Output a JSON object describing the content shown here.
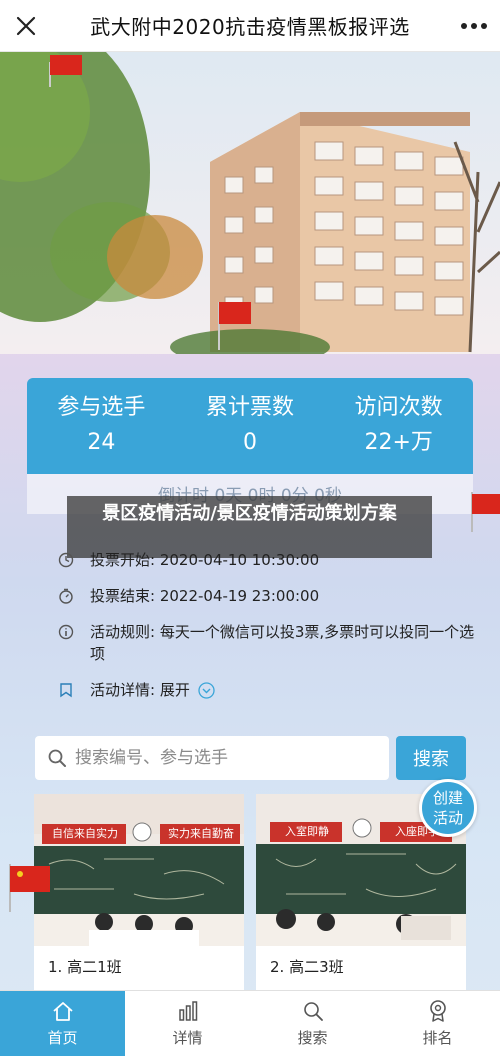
{
  "header": {
    "title": "武大附中2020抗击疫情黑板报评选",
    "close_icon": "close-icon",
    "more_icon": "more-dots-icon"
  },
  "stats": {
    "items": [
      {
        "label": "参与选手",
        "value": "24"
      },
      {
        "label": "累计票数",
        "value": "0"
      },
      {
        "label": "访问次数",
        "value": "22+万"
      }
    ],
    "countdown": "倒计时 0天 0时 0分 0秒"
  },
  "overlay_caption": "景区疫情活动/景区疫情活动策划方案",
  "info": {
    "vote_start": "投票开始: 2020-04-10 10:30:00",
    "vote_end": "投票结束: 2022-04-19 23:00:00",
    "rules": "活动规则: 每天一个微信可以投3票,多票时可以投同一个选项",
    "details": "活动详情: 展开"
  },
  "search": {
    "placeholder": "搜索编号、参与选手",
    "button_label": "搜索"
  },
  "create_button": {
    "line1": "创建",
    "line2": "活动"
  },
  "cards": [
    {
      "caption": "1. 高二1班",
      "banner_left": "自信来自实力",
      "banner_right": "实力来自勤奋"
    },
    {
      "caption": "2. 高二3班",
      "banner_left": "入室即静",
      "banner_right": "入座即学"
    }
  ],
  "bottom_nav": [
    {
      "label": "首页",
      "icon": "home-icon",
      "active": true
    },
    {
      "label": "详情",
      "icon": "bar-chart-icon",
      "active": false
    },
    {
      "label": "搜索",
      "icon": "search-icon",
      "active": false
    },
    {
      "label": "排名",
      "icon": "medal-icon",
      "active": false
    }
  ],
  "colors": {
    "accent": "#3aa5d8",
    "flag_red": "#d9261c"
  }
}
